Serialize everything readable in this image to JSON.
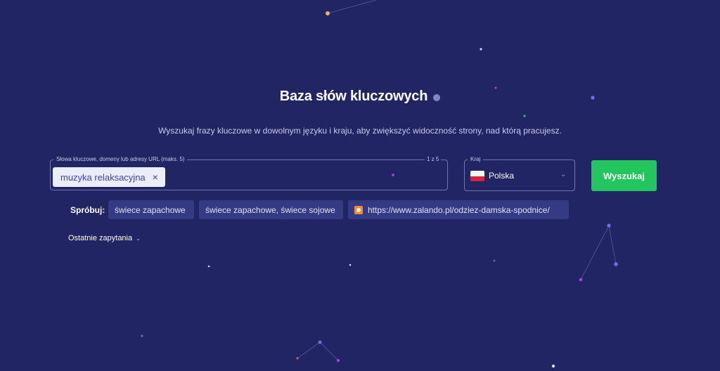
{
  "header": {
    "title": "Baza słów kluczowych",
    "subtitle": "Wyszukaj frazy kluczowe w dowolnym języku i kraju, aby zwiększyć widoczność strony, nad którą pracujesz."
  },
  "keyword_field": {
    "label": "Słowa kluczowe, domeny lub adresy URL (maks. 5)",
    "count": "1 z 5",
    "chips": [
      "muzyka relaksacyjna"
    ],
    "chip_remove_icon": "×"
  },
  "country_field": {
    "label": "Kraj",
    "value": "Polska",
    "flag": "poland-flag-icon",
    "chevron": "⌄"
  },
  "search_button": {
    "label": "Wyszukaj",
    "color": "#22c55e"
  },
  "suggestions": {
    "label": "Spróbuj:",
    "items": [
      "świece zapachowe",
      "świece zapachowe, świece sojowe",
      "https://www.zalando.pl/odziez-damska-spodnice/"
    ]
  },
  "recent": {
    "label": "Ostatnie zapytania",
    "chevron": "⌄"
  },
  "colors": {
    "background": "#212563",
    "accent": "#22c55e",
    "chip_text": "#3b40b5"
  }
}
